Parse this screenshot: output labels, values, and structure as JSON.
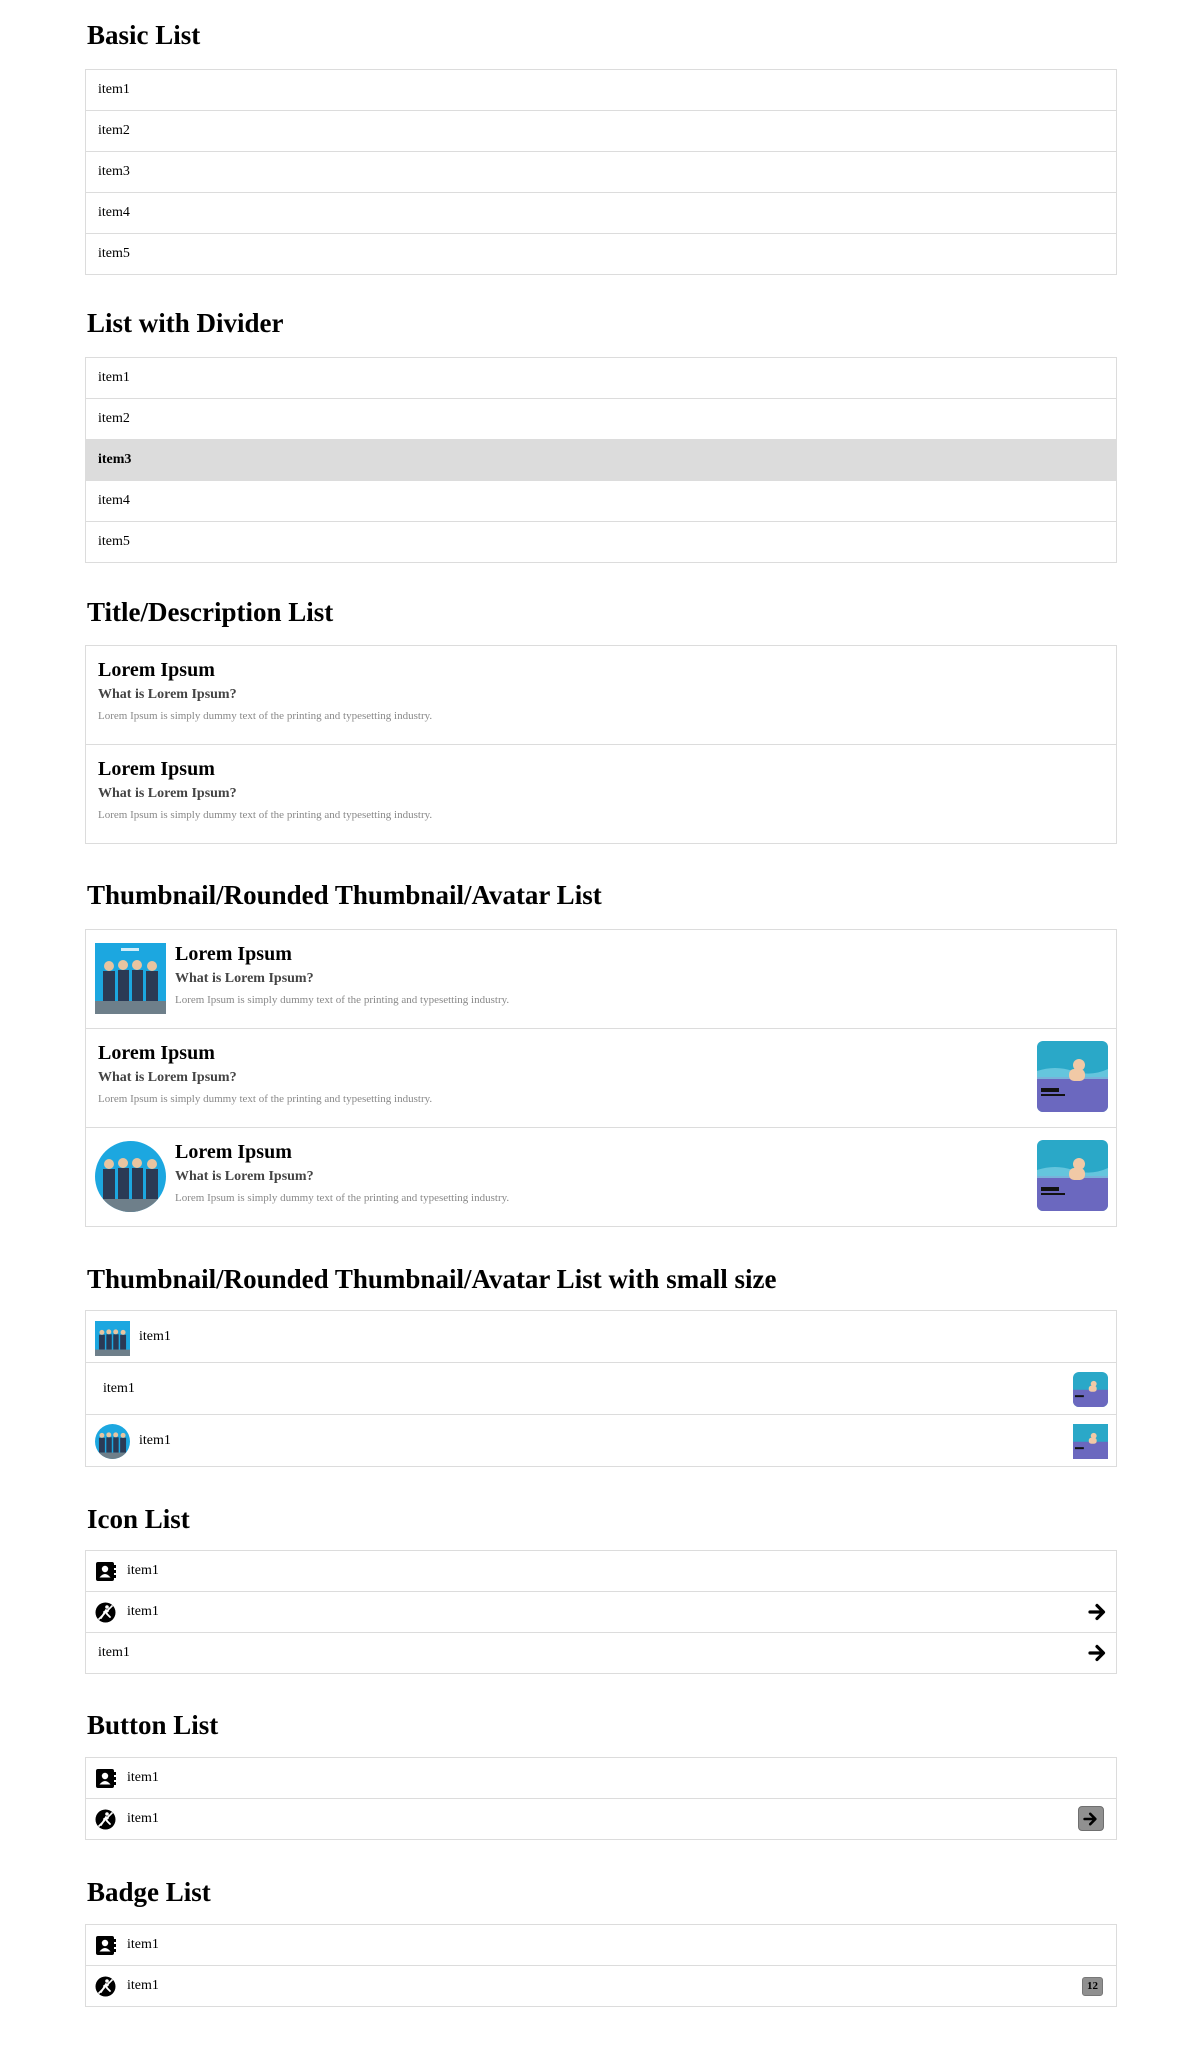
{
  "sections": {
    "basic": {
      "title": "Basic List",
      "items": [
        "item1",
        "item2",
        "item3",
        "item4",
        "item5"
      ]
    },
    "divider": {
      "title": "List with Divider",
      "items": [
        "item1",
        "item2",
        "item3",
        "item4",
        "item5"
      ],
      "divider_label": "item3"
    },
    "title_desc": {
      "title": "Title/Description List",
      "items": [
        {
          "title": "Lorem Ipsum",
          "subtitle": "What is Lorem Ipsum?",
          "description": "Lorem Ipsum is simply dummy text of the printing and typesetting industry."
        },
        {
          "title": "Lorem Ipsum",
          "subtitle": "What is Lorem Ipsum?",
          "description": "Lorem Ipsum is simply dummy text of the printing and typesetting industry."
        }
      ]
    },
    "thumbnail": {
      "title": "Thumbnail/Rounded Thumbnail/Avatar List",
      "items": [
        {
          "title": "Lorem Ipsum",
          "subtitle": "What is Lorem Ipsum?",
          "description": "Lorem Ipsum is simply dummy text of the printing and typesetting industry."
        },
        {
          "title": "Lorem Ipsum",
          "subtitle": "What is Lorem Ipsum?",
          "description": "Lorem Ipsum is simply dummy text of the printing and typesetting industry."
        },
        {
          "title": "Lorem Ipsum",
          "subtitle": "What is Lorem Ipsum?",
          "description": "Lorem Ipsum is simply dummy text of the printing and typesetting industry."
        }
      ]
    },
    "thumbnail_small": {
      "title": "Thumbnail/Rounded Thumbnail/Avatar List with small size",
      "items": [
        "item1",
        "item1",
        "item1"
      ]
    },
    "icon": {
      "title": "Icon List",
      "items": [
        "item1",
        "item1",
        "item1"
      ],
      "icons": [
        "contact-book-icon",
        "no-walking-icon",
        "none"
      ]
    },
    "button": {
      "title": "Button List",
      "items": [
        "item1",
        "item1"
      ]
    },
    "badge": {
      "title": "Badge List",
      "items": [
        "item1",
        "item1"
      ],
      "badge_count": "12"
    }
  },
  "colors": {
    "divider_bg": "#dcdcdc",
    "border": "#dcdcdc",
    "button_bg": "#909090",
    "album_sky": "#1ca7e0",
    "album_pool": "#6b68bf"
  }
}
